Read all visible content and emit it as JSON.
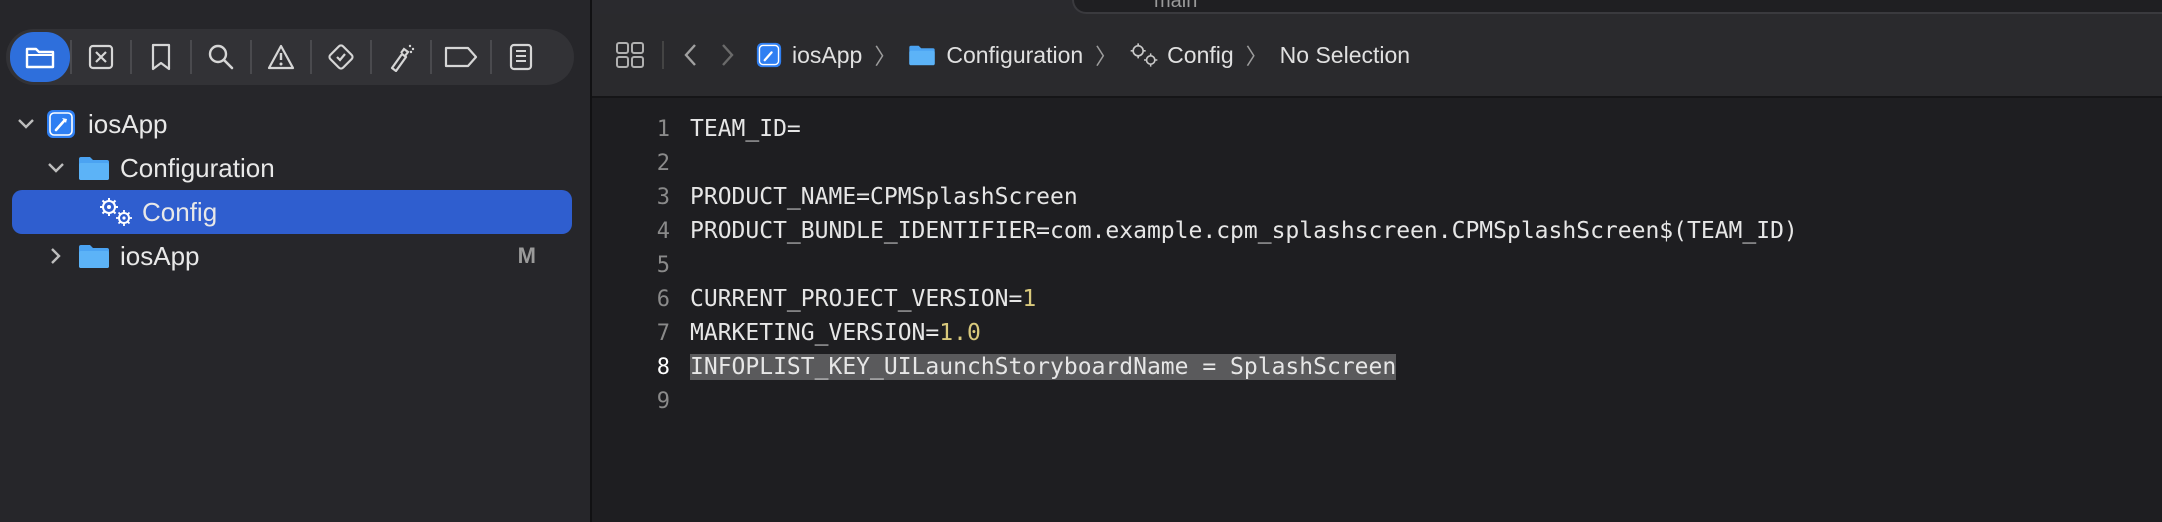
{
  "sidebar": {
    "tree": [
      {
        "label": "iosApp",
        "badge": ""
      },
      {
        "label": "Configuration",
        "badge": ""
      },
      {
        "label": "Config",
        "badge": ""
      },
      {
        "label": "iosApp",
        "badge": "M"
      }
    ]
  },
  "tab": {
    "title": "main"
  },
  "jumpbar": {
    "crumbs": [
      "iosApp",
      "Configuration",
      "Config",
      "No Selection"
    ]
  },
  "code": {
    "current_line": 8,
    "lines": [
      {
        "n": "1",
        "key": "TEAM_ID=",
        "value": ""
      },
      {
        "n": "2",
        "key": "",
        "value": ""
      },
      {
        "n": "3",
        "key": "PRODUCT_NAME=CPMSplashScreen",
        "value": ""
      },
      {
        "n": "4",
        "key": "PRODUCT_BUNDLE_IDENTIFIER=com.example.cpm_splashscreen.CPMSplashScreen$(TEAM_ID)",
        "value": ""
      },
      {
        "n": "5",
        "key": "",
        "value": ""
      },
      {
        "n": "6",
        "key": "CURRENT_PROJECT_VERSION=",
        "value": "1"
      },
      {
        "n": "7",
        "key": "MARKETING_VERSION=",
        "value": "1.0"
      },
      {
        "n": "8",
        "key": "INFOPLIST_KEY_UILaunchStoryboardName = SplashScreen",
        "value": ""
      },
      {
        "n": "9",
        "key": "",
        "value": ""
      }
    ]
  },
  "colors": {
    "accent": "#2e6fdc",
    "selection": "#2f5ecf",
    "number": "#d9c97c"
  }
}
